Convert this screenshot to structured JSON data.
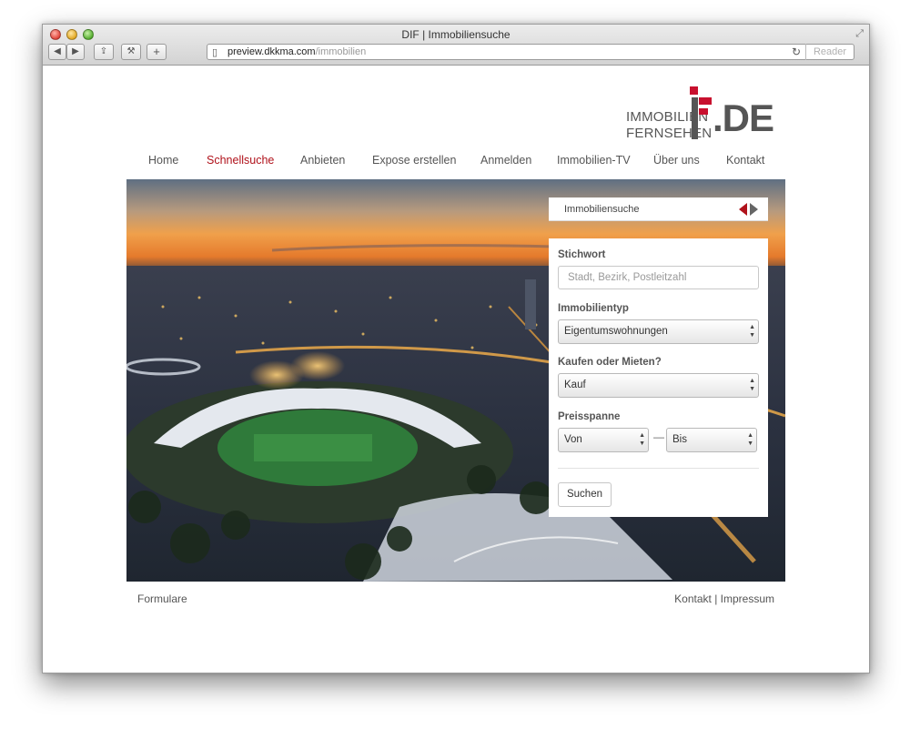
{
  "browser": {
    "window_title": "DIF | Immobiliensuche",
    "address_domain": "preview.dkkma.com",
    "address_path": "/immobilien",
    "reader_label": "Reader",
    "toolbar_glyphs": {
      "back": "◀",
      "forward": "▶",
      "share": "⇪",
      "settings": "⚒",
      "new_tab": "+",
      "reload": "↻",
      "resize": "⤢",
      "page_icon": "▯"
    }
  },
  "logo": {
    "line1": "IMMOBILIEN",
    "line2": "FERNSEHEN",
    "suffix": ".DE",
    "accent_color": "#c8102e"
  },
  "nav": {
    "items": [
      {
        "label": "Home",
        "active": false
      },
      {
        "label": "Schnellsuche",
        "active": true
      },
      {
        "label": "Anbieten",
        "active": false
      },
      {
        "label": "Expose erstellen",
        "active": false
      },
      {
        "label": "Anmelden",
        "active": false
      },
      {
        "label": "Immobilien-TV",
        "active": false
      },
      {
        "label": "Über uns",
        "active": false
      },
      {
        "label": "Kontakt",
        "active": false
      }
    ],
    "active_color": "#b0121b"
  },
  "search": {
    "header_label": "Immobiliensuche",
    "keyword": {
      "label": "Stichwort",
      "placeholder": "Stadt, Bezirk, Postleitzahl"
    },
    "property_type": {
      "label": "Immobilientyp",
      "value": "Eigentumswohnungen"
    },
    "buy_rent": {
      "label": "Kaufen oder Mieten?",
      "value": "Kauf"
    },
    "price": {
      "label": "Preisspanne",
      "from": "Von",
      "separator": "—",
      "to": "Bis"
    },
    "submit_label": "Suchen",
    "select_arrow_up": "▲",
    "select_arrow_down": "▼"
  },
  "footer": {
    "left": "Formulare",
    "kontakt": "Kontakt",
    "separator": "|",
    "impressum": "Impressum"
  }
}
